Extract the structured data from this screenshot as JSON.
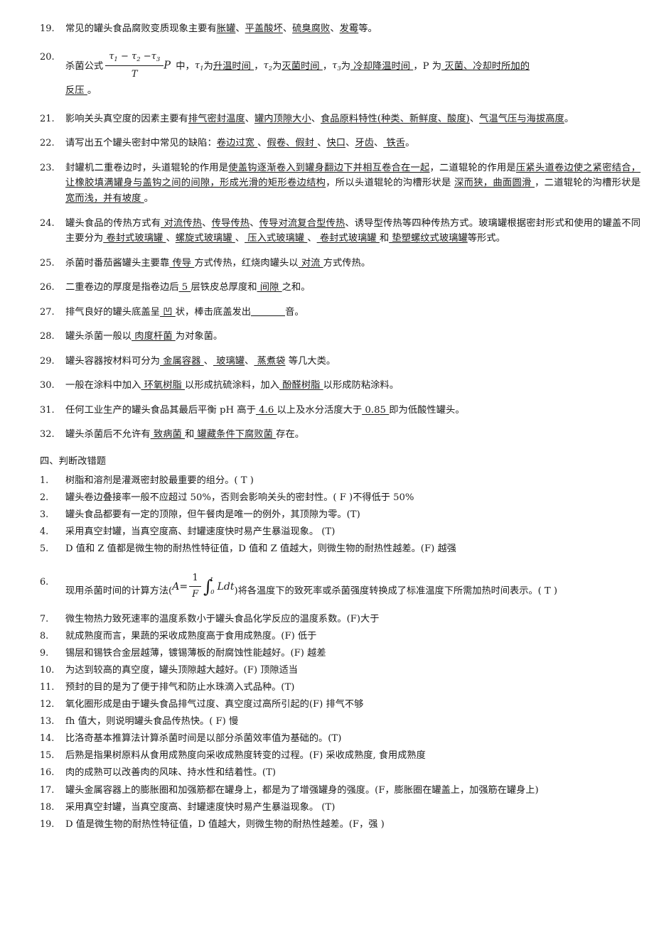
{
  "document": {
    "fill_in_blank_items": [
      {
        "number": "19.",
        "segments": [
          {
            "t": "常见的罐头食品腐败变质现象主要有",
            "u": false
          },
          {
            "t": "胀罐",
            "u": true
          },
          {
            "t": "、",
            "u": false
          },
          {
            "t": "平盖酸坏",
            "u": true
          },
          {
            "t": "、",
            "u": false
          },
          {
            "t": "硫臭腐败",
            "u": true
          },
          {
            "t": "、",
            "u": false
          },
          {
            "t": "发霉",
            "u": true
          },
          {
            "t": "等。",
            "u": false
          }
        ]
      },
      {
        "number": "21.",
        "segments": [
          {
            "t": "影响关头真空度的因素主要有",
            "u": false
          },
          {
            "t": "排气密封温度",
            "u": true
          },
          {
            "t": "、",
            "u": false
          },
          {
            "t": "罐内顶隙大小",
            "u": true
          },
          {
            "t": "、",
            "u": false
          },
          {
            "t": "食品原料特性(种类、新鲜度、酸度)",
            "u": true
          },
          {
            "t": "、",
            "u": false
          },
          {
            "t": "气温气压与海拔高度",
            "u": true
          },
          {
            "t": "。",
            "u": false
          }
        ]
      },
      {
        "number": "22.",
        "segments": [
          {
            "t": "请写出五个罐头密封中常见的缺陷：",
            "u": false
          },
          {
            "t": "卷边过宽 ",
            "u": true
          },
          {
            "t": " 、",
            "u": false
          },
          {
            "t": "假卷、假封 ",
            "u": true
          },
          {
            "t": "、",
            "u": false
          },
          {
            "t": "快口",
            "u": true
          },
          {
            "t": "、",
            "u": false
          },
          {
            "t": "牙齿",
            "u": true
          },
          {
            "t": "、",
            "u": false
          },
          {
            "t": " 铁舌",
            "u": true
          },
          {
            "t": "。",
            "u": false
          }
        ]
      },
      {
        "number": "23.",
        "segments": [
          {
            "t": "封罐机二重卷边时，头道辊轮的作用是",
            "u": false
          },
          {
            "t": "使盖钩逐渐卷入到罐身翻边下并相互卷合在一起",
            "u": true
          },
          {
            "t": "，二道辊轮的作用是",
            "u": false
          },
          {
            "t": "压紧头道卷边使之紧密结合，让橡胶填满罐身与盖钩之间的间隙，形成光滑的矩形卷边结构",
            "u": true
          },
          {
            "t": "，所以头道辊轮的沟槽形状是 ",
            "u": false
          },
          {
            "t": "深而狭，曲面圆滑  ",
            "u": true
          },
          {
            "t": "，二道辊轮的沟槽形状是",
            "u": false
          },
          {
            "t": " 宽而浅，并有坡度   ",
            "u": true
          },
          {
            "t": "。",
            "u": false
          }
        ]
      },
      {
        "number": "24.",
        "segments": [
          {
            "t": "罐头食品的传热方式有",
            "u": false
          },
          {
            "t": " 对流传热",
            "u": true
          },
          {
            "t": "、",
            "u": false
          },
          {
            "t": "传导传热",
            "u": true
          },
          {
            "t": "、",
            "u": false
          },
          {
            "t": "传导对流复合型传热",
            "u": true
          },
          {
            "t": "、诱导型传热等四种传热方式。玻璃罐根据密封形式和使用的罐盖不同主要分为",
            "u": false
          },
          {
            "t": " 卷封式玻璃罐 ",
            "u": true
          },
          {
            "t": "、",
            "u": false
          },
          {
            "t": "螺旋式玻璃罐   ",
            "u": true
          },
          {
            "t": " 、",
            "u": false
          },
          {
            "t": " 压入式玻璃罐 ",
            "u": true
          },
          {
            "t": " 、",
            "u": false
          },
          {
            "t": " 卷封式玻璃罐  ",
            "u": true
          },
          {
            "t": " 和",
            "u": false
          },
          {
            "t": " 垫塑螺纹式玻璃罐",
            "u": true
          },
          {
            "t": "等形式。",
            "u": false
          }
        ]
      },
      {
        "number": "25.",
        "segments": [
          {
            "t": "杀菌时番茄酱罐头主要靠",
            "u": false
          },
          {
            "t": "  传导 ",
            "u": true
          },
          {
            "t": "方式传热，红烧肉罐头以",
            "u": false
          },
          {
            "t": "  对流 ",
            "u": true
          },
          {
            "t": "方式传热。",
            "u": false
          }
        ]
      },
      {
        "number": "26.",
        "segments": [
          {
            "t": "二重卷边的厚度是指卷边后",
            "u": false
          },
          {
            "t": "  5  ",
            "u": true
          },
          {
            "t": "层铁皮总厚度和",
            "u": false
          },
          {
            "t": "  间隙     ",
            "u": true
          },
          {
            "t": "之和。",
            "u": false
          }
        ]
      },
      {
        "number": "27.",
        "segments": [
          {
            "t": "排气良好的罐头底盖呈",
            "u": false
          },
          {
            "t": " 凹 ",
            "u": true
          },
          {
            "t": "状，棒击底盖发出",
            "u": false
          },
          {
            "t": "BLANK",
            "u": false,
            "blank": true
          },
          {
            "t": "音。",
            "u": false
          }
        ]
      },
      {
        "number": "28.",
        "segments": [
          {
            "t": "罐头杀菌一般以",
            "u": false
          },
          {
            "t": "  肉度杆菌  ",
            "u": true
          },
          {
            "t": "为对象菌。",
            "u": false
          }
        ]
      },
      {
        "number": "29.",
        "segments": [
          {
            "t": "罐头容器按材料可分为",
            "u": false
          },
          {
            "t": "   金属容器  ",
            "u": true
          },
          {
            "t": "、",
            "u": false
          },
          {
            "t": " 玻璃罐",
            "u": true
          },
          {
            "t": "、",
            "u": false
          },
          {
            "t": " 蒸煮袋",
            "u": true
          },
          {
            "t": " 等几大类。",
            "u": false
          }
        ]
      },
      {
        "number": "30.",
        "segments": [
          {
            "t": "一般在涂料中加入",
            "u": false
          },
          {
            "t": "  环氧树脂  ",
            "u": true
          },
          {
            "t": "以形成抗硫涂料，加入",
            "u": false
          },
          {
            "t": "   酚醛树脂 ",
            "u": true
          },
          {
            "t": "以形成防粘涂料。",
            "u": false
          }
        ]
      },
      {
        "number": "31.",
        "segments": [
          {
            "t": "任何工业生产的罐头食品其最后平衡 pH 高于",
            "u": false
          },
          {
            "t": " 4.6 ",
            "u": true
          },
          {
            "t": "以上及水分活度大于",
            "u": false
          },
          {
            "t": " 0.85     ",
            "u": true
          },
          {
            "t": "即为低酸性罐头。",
            "u": false
          }
        ]
      },
      {
        "number": "32.",
        "segments": [
          {
            "t": "罐头杀菌后不允许有",
            "u": false
          },
          {
            "t": " 致病菌  ",
            "u": true
          },
          {
            "t": "和",
            "u": false
          },
          {
            "t": "  罐藏条件下腐败菌   ",
            "u": true
          },
          {
            "t": "存在。",
            "u": false
          }
        ]
      }
    ],
    "q20": {
      "number": "20.",
      "lead": "杀菌公式",
      "formula": {
        "numerator": "τ₁ − τ₂ − τ₃",
        "denominator": "T",
        "trailing_symbol": "P",
        "tau1": "τ",
        "tau2": "τ",
        "tau3": "τ",
        "sub1": "1",
        "sub2": "2",
        "sub3": "3",
        "minus": "−"
      },
      "after_formula": " 中，",
      "p1_label": "为",
      "p1_value": "升温时间 ",
      "sep1": "，",
      "p2_label": "为",
      "p2_value": "灭菌时间 ",
      "sep2": "，",
      "p3_label": "为",
      "p3_value": " 冷却降温时间 ",
      "sep3": "，P 为",
      "p4_value": " 灭菌、冷却时所加的",
      "line2_value": "反压 ",
      "line2_tail": "。"
    },
    "section_heading": "四、判断改错题",
    "true_false_items": [
      {
        "number": "1.",
        "text": "树脂和溶剂是灌溉密封胶最重要的组分。( T )"
      },
      {
        "number": "2.",
        "text": "罐头卷边叠接率一般不应超过 50%，否则会影响关头的密封性。( F )不得低于 50%"
      },
      {
        "number": "3.",
        "text": "罐头食品都要有一定的顶隙，但午餐肉是唯一的例外，其顶隙为零。(T)"
      },
      {
        "number": "4.",
        "text": "采用真空封罐，当真空度高、封罐速度快时易产生暴溢现象。 (T)"
      },
      {
        "number": "5.",
        "text": "D 值和 Z 值都是微生物的耐热性特征值，D 值和 Z 值越大，则微生物的耐热性越差。(F)  越强"
      },
      {
        "number": "7.",
        "text": "微生物热力致死速率的温度系数小于罐头食品化学反应的温度系数。(F)大于"
      },
      {
        "number": "8.",
        "text": "就成熟度而言，果蔬的采收成熟度高于食用成熟度。(F) 低于"
      },
      {
        "number": "9.",
        "text": "锡层和锡铁合金层越薄，镀锡薄板的耐腐蚀性能越好。(F) 越差"
      },
      {
        "number": "10.",
        "text": "为达到较高的真空度，罐头顶隙越大越好。(F)   顶隙适当"
      },
      {
        "number": "11.",
        "text": "预封的目的是为了便于排气和防止水珠滴入式品种。(T)"
      },
      {
        "number": "12.",
        "text": "氧化圈形成是由于罐头食品排气过度、真空度过高所引起的(F)  排气不够"
      },
      {
        "number": "13.",
        "text": "fh 值大，则说明罐头食品传热快。(  F) 慢"
      },
      {
        "number": "14.",
        "text": "比洛奇基本推算法计算杀菌时间是以部分杀菌效率值为基础的。(T)"
      },
      {
        "number": "15.",
        "text": "后熟是指果树原料从食用成熟度向采收成熟度转变的过程。(F)  采收成熟度, 食用成熟度"
      },
      {
        "number": "16.",
        "text": "肉的成熟可以改善肉的风味、持水性和结着性。(T)"
      },
      {
        "number": "17.",
        "text": "罐头金属容器上的膨胀圈和加强筋都在罐身上，都是为了增强罐身的强度。(F，膨胀圈在罐盖上，加强筋在罐身上)"
      },
      {
        "number": "18.",
        "text": "采用真空封罐，当真空度高、封罐速度快时易产生暴溢现象。 (T)"
      },
      {
        "number": "19.",
        "text": "D 值是微生物的耐热性特征值，D 值越大，则微生物的耐热性越差。(F，强 )"
      }
    ],
    "q6": {
      "number": "6.",
      "before": "现用杀菌时间的计算方法(",
      "formula": {
        "lhs": "A",
        "equals": "=",
        "num": "1",
        "den": "F",
        "integral": "∫",
        "upper": "t",
        "lower": "0",
        "integrand": "Ldt"
      },
      "after": ")将各温度下的致死率或杀菌强度转换成了标准温度下所需加热时间表示。( T )"
    }
  }
}
